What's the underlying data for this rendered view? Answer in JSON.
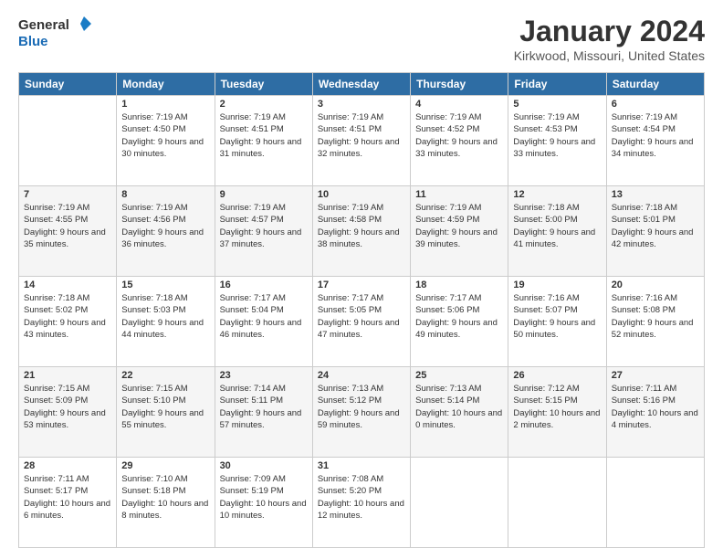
{
  "header": {
    "logo_general": "General",
    "logo_blue": "Blue",
    "month_title": "January 2024",
    "location": "Kirkwood, Missouri, United States"
  },
  "weekdays": [
    "Sunday",
    "Monday",
    "Tuesday",
    "Wednesday",
    "Thursday",
    "Friday",
    "Saturday"
  ],
  "weeks": [
    [
      {
        "day": "",
        "sunrise": "",
        "sunset": "",
        "daylight": ""
      },
      {
        "day": "1",
        "sunrise": "Sunrise: 7:19 AM",
        "sunset": "Sunset: 4:50 PM",
        "daylight": "Daylight: 9 hours and 30 minutes."
      },
      {
        "day": "2",
        "sunrise": "Sunrise: 7:19 AM",
        "sunset": "Sunset: 4:51 PM",
        "daylight": "Daylight: 9 hours and 31 minutes."
      },
      {
        "day": "3",
        "sunrise": "Sunrise: 7:19 AM",
        "sunset": "Sunset: 4:51 PM",
        "daylight": "Daylight: 9 hours and 32 minutes."
      },
      {
        "day": "4",
        "sunrise": "Sunrise: 7:19 AM",
        "sunset": "Sunset: 4:52 PM",
        "daylight": "Daylight: 9 hours and 33 minutes."
      },
      {
        "day": "5",
        "sunrise": "Sunrise: 7:19 AM",
        "sunset": "Sunset: 4:53 PM",
        "daylight": "Daylight: 9 hours and 33 minutes."
      },
      {
        "day": "6",
        "sunrise": "Sunrise: 7:19 AM",
        "sunset": "Sunset: 4:54 PM",
        "daylight": "Daylight: 9 hours and 34 minutes."
      }
    ],
    [
      {
        "day": "7",
        "sunrise": "Sunrise: 7:19 AM",
        "sunset": "Sunset: 4:55 PM",
        "daylight": "Daylight: 9 hours and 35 minutes."
      },
      {
        "day": "8",
        "sunrise": "Sunrise: 7:19 AM",
        "sunset": "Sunset: 4:56 PM",
        "daylight": "Daylight: 9 hours and 36 minutes."
      },
      {
        "day": "9",
        "sunrise": "Sunrise: 7:19 AM",
        "sunset": "Sunset: 4:57 PM",
        "daylight": "Daylight: 9 hours and 37 minutes."
      },
      {
        "day": "10",
        "sunrise": "Sunrise: 7:19 AM",
        "sunset": "Sunset: 4:58 PM",
        "daylight": "Daylight: 9 hours and 38 minutes."
      },
      {
        "day": "11",
        "sunrise": "Sunrise: 7:19 AM",
        "sunset": "Sunset: 4:59 PM",
        "daylight": "Daylight: 9 hours and 39 minutes."
      },
      {
        "day": "12",
        "sunrise": "Sunrise: 7:18 AM",
        "sunset": "Sunset: 5:00 PM",
        "daylight": "Daylight: 9 hours and 41 minutes."
      },
      {
        "day": "13",
        "sunrise": "Sunrise: 7:18 AM",
        "sunset": "Sunset: 5:01 PM",
        "daylight": "Daylight: 9 hours and 42 minutes."
      }
    ],
    [
      {
        "day": "14",
        "sunrise": "Sunrise: 7:18 AM",
        "sunset": "Sunset: 5:02 PM",
        "daylight": "Daylight: 9 hours and 43 minutes."
      },
      {
        "day": "15",
        "sunrise": "Sunrise: 7:18 AM",
        "sunset": "Sunset: 5:03 PM",
        "daylight": "Daylight: 9 hours and 44 minutes."
      },
      {
        "day": "16",
        "sunrise": "Sunrise: 7:17 AM",
        "sunset": "Sunset: 5:04 PM",
        "daylight": "Daylight: 9 hours and 46 minutes."
      },
      {
        "day": "17",
        "sunrise": "Sunrise: 7:17 AM",
        "sunset": "Sunset: 5:05 PM",
        "daylight": "Daylight: 9 hours and 47 minutes."
      },
      {
        "day": "18",
        "sunrise": "Sunrise: 7:17 AM",
        "sunset": "Sunset: 5:06 PM",
        "daylight": "Daylight: 9 hours and 49 minutes."
      },
      {
        "day": "19",
        "sunrise": "Sunrise: 7:16 AM",
        "sunset": "Sunset: 5:07 PM",
        "daylight": "Daylight: 9 hours and 50 minutes."
      },
      {
        "day": "20",
        "sunrise": "Sunrise: 7:16 AM",
        "sunset": "Sunset: 5:08 PM",
        "daylight": "Daylight: 9 hours and 52 minutes."
      }
    ],
    [
      {
        "day": "21",
        "sunrise": "Sunrise: 7:15 AM",
        "sunset": "Sunset: 5:09 PM",
        "daylight": "Daylight: 9 hours and 53 minutes."
      },
      {
        "day": "22",
        "sunrise": "Sunrise: 7:15 AM",
        "sunset": "Sunset: 5:10 PM",
        "daylight": "Daylight: 9 hours and 55 minutes."
      },
      {
        "day": "23",
        "sunrise": "Sunrise: 7:14 AM",
        "sunset": "Sunset: 5:11 PM",
        "daylight": "Daylight: 9 hours and 57 minutes."
      },
      {
        "day": "24",
        "sunrise": "Sunrise: 7:13 AM",
        "sunset": "Sunset: 5:12 PM",
        "daylight": "Daylight: 9 hours and 59 minutes."
      },
      {
        "day": "25",
        "sunrise": "Sunrise: 7:13 AM",
        "sunset": "Sunset: 5:14 PM",
        "daylight": "Daylight: 10 hours and 0 minutes."
      },
      {
        "day": "26",
        "sunrise": "Sunrise: 7:12 AM",
        "sunset": "Sunset: 5:15 PM",
        "daylight": "Daylight: 10 hours and 2 minutes."
      },
      {
        "day": "27",
        "sunrise": "Sunrise: 7:11 AM",
        "sunset": "Sunset: 5:16 PM",
        "daylight": "Daylight: 10 hours and 4 minutes."
      }
    ],
    [
      {
        "day": "28",
        "sunrise": "Sunrise: 7:11 AM",
        "sunset": "Sunset: 5:17 PM",
        "daylight": "Daylight: 10 hours and 6 minutes."
      },
      {
        "day": "29",
        "sunrise": "Sunrise: 7:10 AM",
        "sunset": "Sunset: 5:18 PM",
        "daylight": "Daylight: 10 hours and 8 minutes."
      },
      {
        "day": "30",
        "sunrise": "Sunrise: 7:09 AM",
        "sunset": "Sunset: 5:19 PM",
        "daylight": "Daylight: 10 hours and 10 minutes."
      },
      {
        "day": "31",
        "sunrise": "Sunrise: 7:08 AM",
        "sunset": "Sunset: 5:20 PM",
        "daylight": "Daylight: 10 hours and 12 minutes."
      },
      {
        "day": "",
        "sunrise": "",
        "sunset": "",
        "daylight": ""
      },
      {
        "day": "",
        "sunrise": "",
        "sunset": "",
        "daylight": ""
      },
      {
        "day": "",
        "sunrise": "",
        "sunset": "",
        "daylight": ""
      }
    ]
  ]
}
